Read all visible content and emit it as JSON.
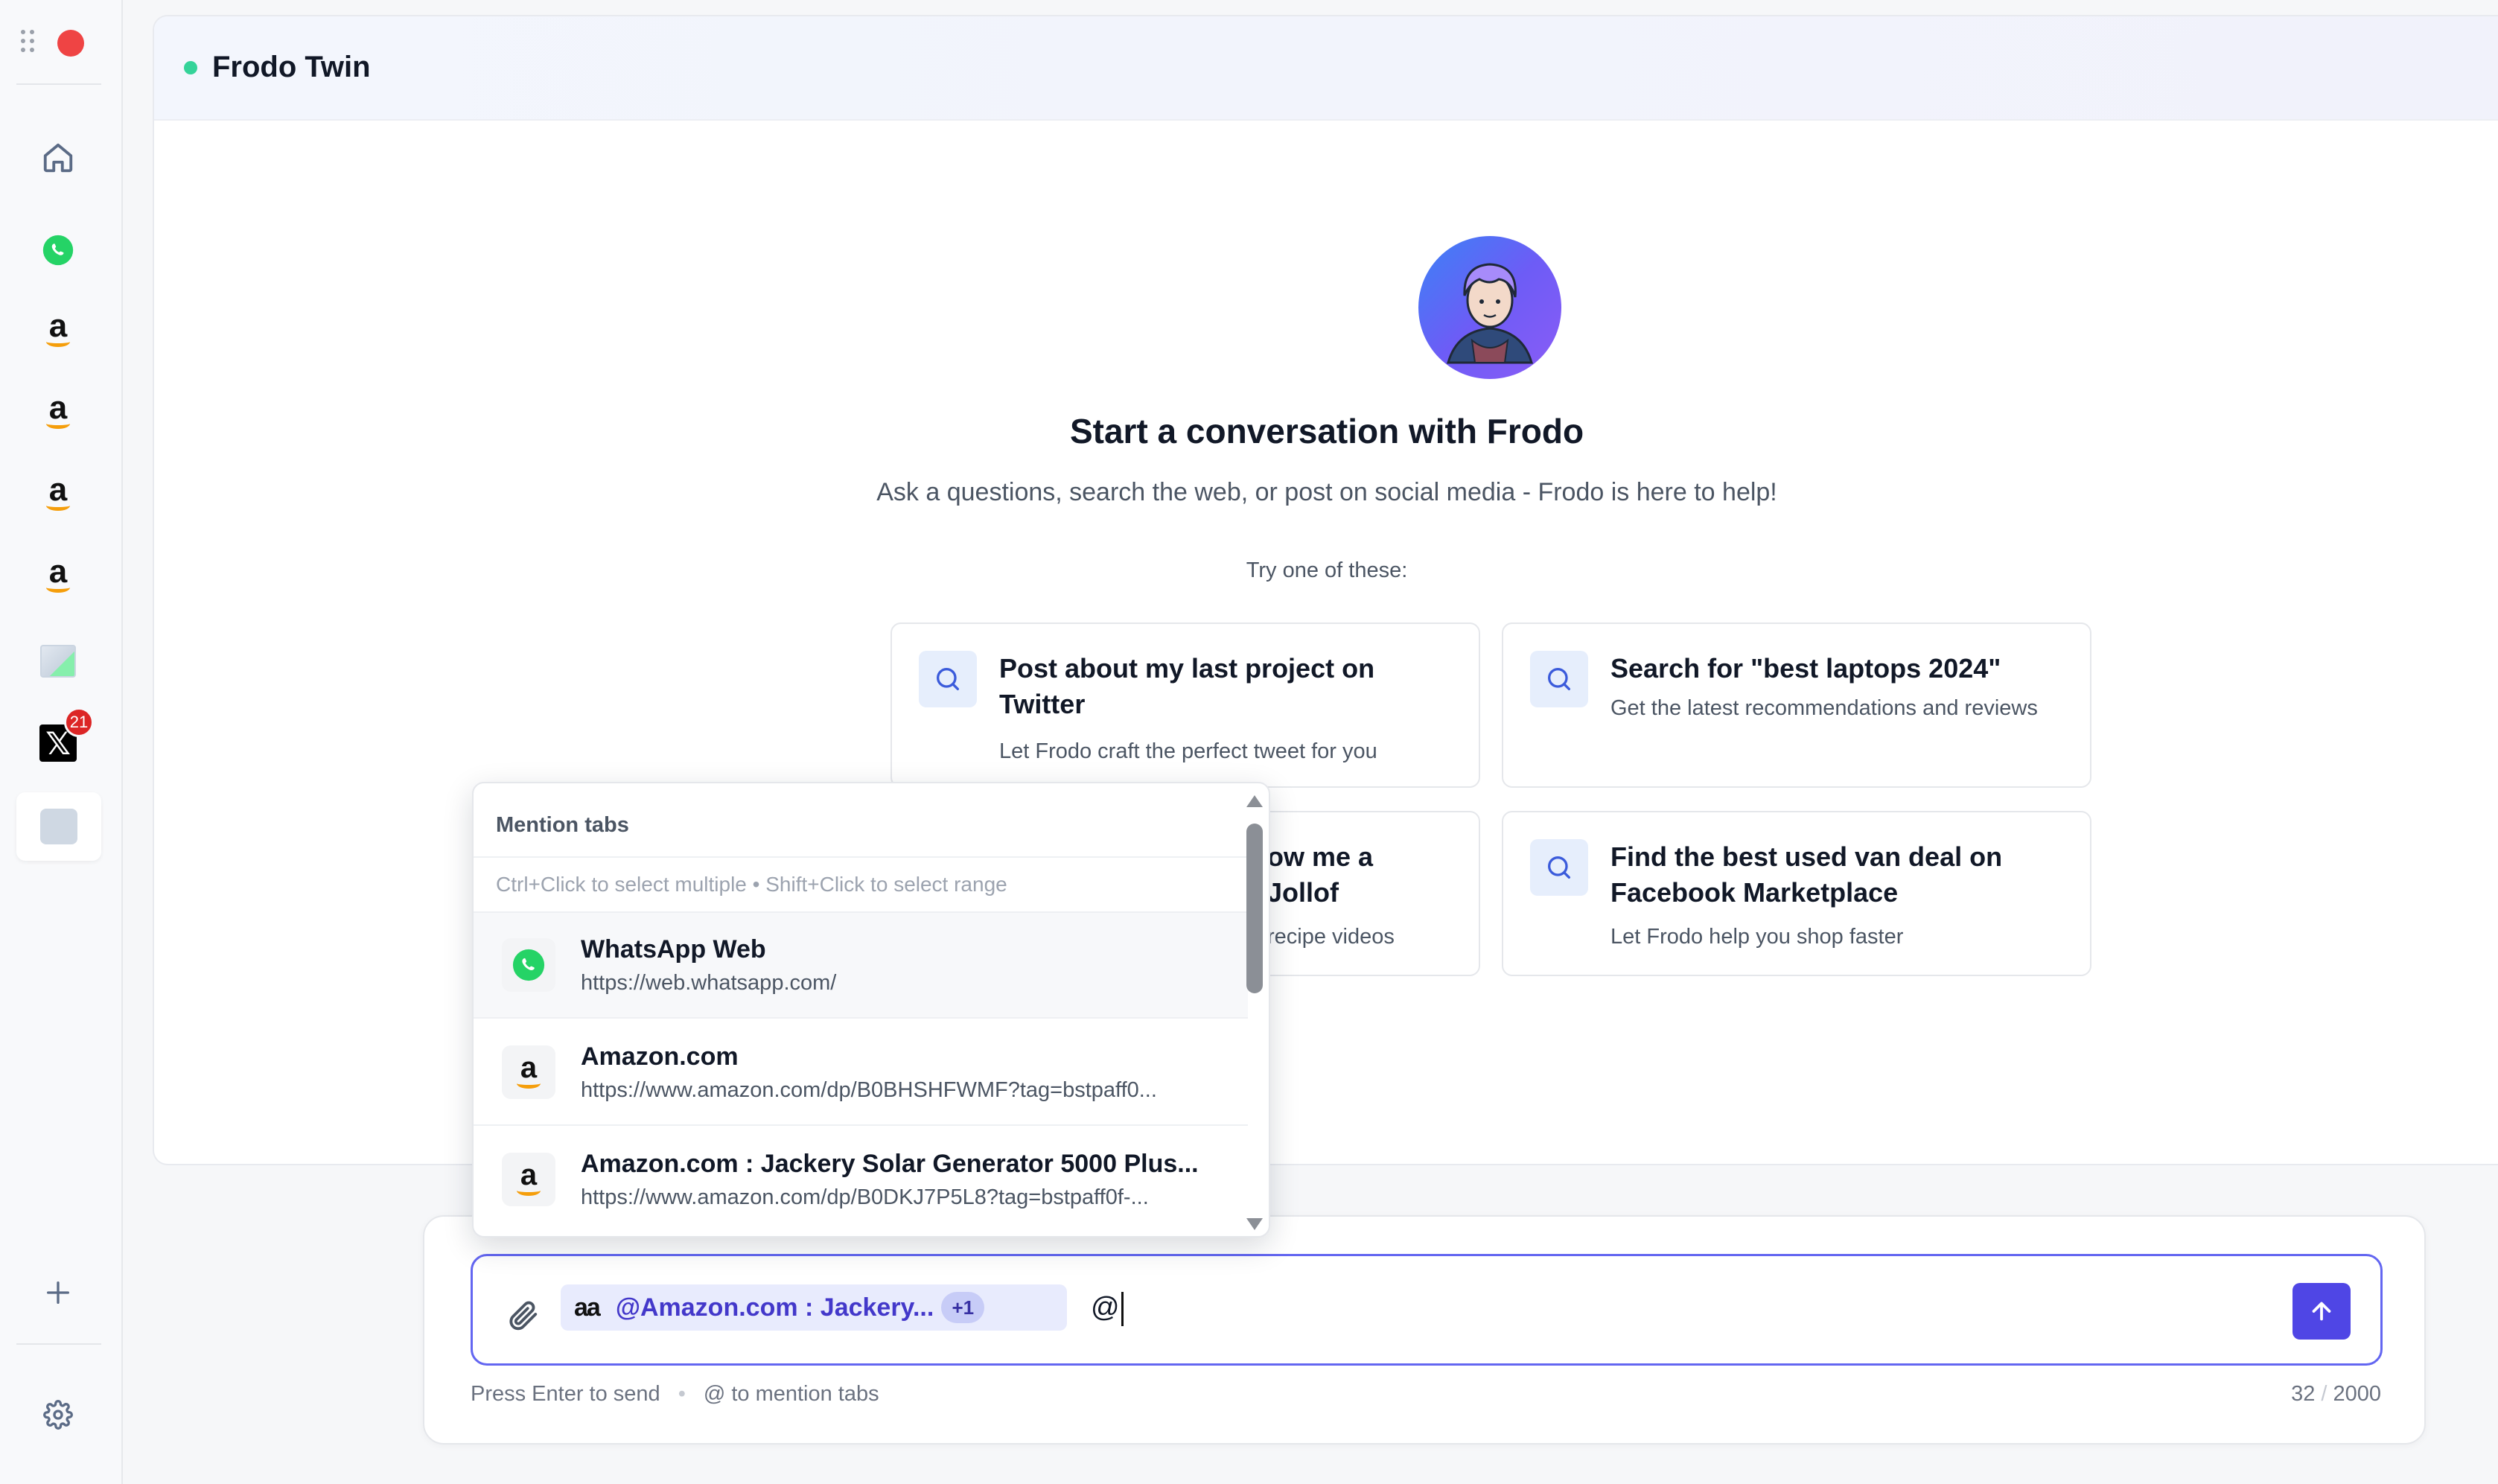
{
  "header": {
    "title": "Frodo Twin",
    "status_color": "#34d399"
  },
  "sidebar": {
    "items": [
      {
        "name": "home",
        "icon": "home-icon"
      },
      {
        "name": "whatsapp",
        "icon": "whatsapp-icon"
      },
      {
        "name": "amazon-1",
        "icon": "amazon-icon",
        "glyph": "a"
      },
      {
        "name": "amazon-2",
        "icon": "amazon-icon",
        "glyph": "a"
      },
      {
        "name": "amazon-3",
        "icon": "amazon-icon",
        "glyph": "a"
      },
      {
        "name": "amazon-4",
        "icon": "amazon-icon",
        "glyph": "a"
      },
      {
        "name": "broken-image",
        "icon": "image-icon"
      },
      {
        "name": "x-twitter",
        "icon": "x-icon",
        "badge": "21"
      },
      {
        "name": "blank-tab",
        "icon": "tab-icon"
      }
    ],
    "x_glyph": "𝕏"
  },
  "welcome": {
    "title": "Start a conversation with Frodo",
    "subtitle": "Ask a questions, search the web, or post on social media - Frodo is here to help!",
    "try_label": "Try one of these:"
  },
  "suggestions": [
    {
      "title": "Post about my last project on Twitter",
      "desc": "Let Frodo craft the perfect tweet for you"
    },
    {
      "title": "Search for \"best laptops 2024\"",
      "desc": "Get the latest recommendations and reviews"
    },
    {
      "title": "ow me a Jollof",
      "desc": "recipe videos"
    },
    {
      "title": "Find the best used van deal on Facebook Marketplace",
      "desc": "Let Frodo help you shop faster"
    }
  ],
  "mention": {
    "title": "Mention tabs",
    "hint": "Ctrl+Click to select multiple • Shift+Click to select range",
    "items": [
      {
        "title": "WhatsApp Web",
        "url": "https://web.whatsapp.com/",
        "icon": "whatsapp-icon"
      },
      {
        "title": "Amazon.com",
        "url": "https://www.amazon.com/dp/B0BHSHFWMF?tag=bstpaff0...",
        "icon": "amazon-icon"
      },
      {
        "title": "Amazon.com : Jackery Solar Generator 5000 Plus...",
        "url": "https://www.amazon.com/dp/B0DKJ7P5L8?tag=bstpaff0f-...",
        "icon": "amazon-icon"
      }
    ]
  },
  "composer": {
    "chip_glyphs": "aa",
    "chip_label": "@Amazon.com : Jackery...",
    "chip_count": "+1",
    "typed_text": "@",
    "hint_send": "Press Enter to send",
    "hint_dot": "•",
    "hint_mention": "@ to mention tabs",
    "count_current": "32",
    "count_slash": "/",
    "count_max": "2000",
    "accent": "#4f46e5"
  }
}
